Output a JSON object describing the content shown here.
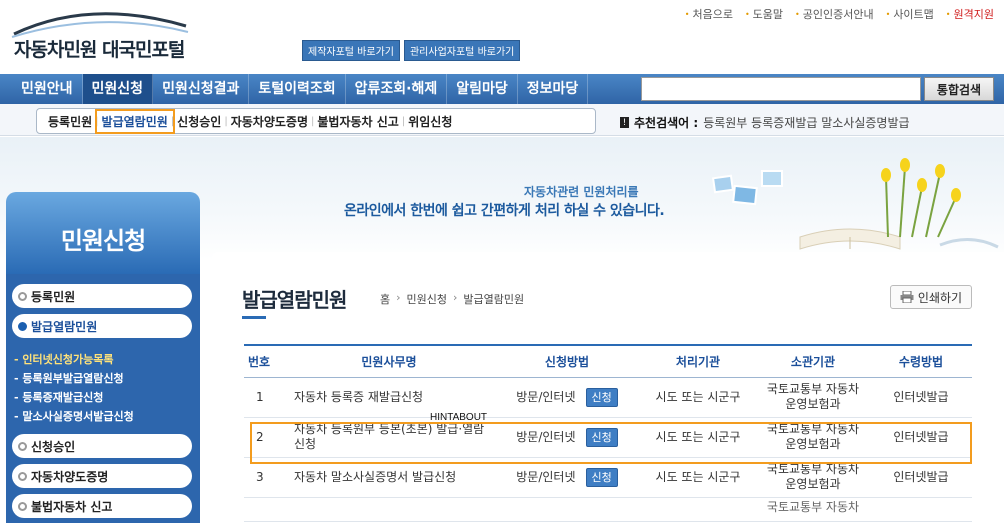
{
  "util_links": [
    {
      "label": "처음으로",
      "red": false
    },
    {
      "label": "도움말",
      "red": false
    },
    {
      "label": "공인인증서안내",
      "red": false
    },
    {
      "label": "사이트맵",
      "red": false
    },
    {
      "label": "원격지원",
      "red": true
    }
  ],
  "logo": {
    "text": "자동차민원 대국민포털"
  },
  "shortcuts": [
    "제작자포털 바로가기",
    "관리사업자포털 바로가기"
  ],
  "nav": {
    "items": [
      "민원안내",
      "민원신청",
      "민원신청결과",
      "토털이력조회",
      "압류조회·해제",
      "알림마당",
      "정보마당"
    ],
    "active_index": 1,
    "search_value": "",
    "search_button": "통합검색"
  },
  "subnav": {
    "items": [
      "등록민원",
      "발급열람민원",
      "신청승인",
      "자동차양도증명",
      "불법자동차 신고",
      "위임신청"
    ],
    "highlight_index": 1,
    "rec_label": "추천검색어 :",
    "rec_terms": "등록원부  등록증재발급  말소사실증명발급"
  },
  "banner": {
    "line1": "자동차관련 민원처리를",
    "line2": "온라인에서 한번에 쉽고 간편하게 처리 하실 수 있습니다."
  },
  "sidebar": {
    "title": "민원신청",
    "items": [
      "등록민원",
      "발급열람민원"
    ],
    "active_index": 1,
    "subitems": [
      "- 인터넷신청가능목록",
      "- 등록원부발급열람신청",
      "- 등록증재발급신청",
      "- 말소사실증명서발급신청"
    ],
    "items_after": [
      "신청승인",
      "자동차양도증명",
      "불법자동차 신고"
    ]
  },
  "page": {
    "title": "발급열람민원",
    "breadcrumb": [
      "홈",
      "민원신청",
      "발급열람민원"
    ],
    "print_label": "인쇄하기"
  },
  "table": {
    "headers": [
      "번호",
      "민원사무명",
      "신청방법",
      "처리기관",
      "소관기관",
      "수령방법"
    ],
    "apply_label": "신청",
    "rows": [
      {
        "no": "1",
        "name": "자동차 등록증 재발급신청",
        "method": "방문/인터넷",
        "proc": "시도 또는 시군구",
        "owner": "국토교통부 자동차\n운영보험과",
        "recv": "인터넷발급"
      },
      {
        "no": "2",
        "name": "자동차 등록원부 등본(초본) 발급·열람\n신청",
        "method": "방문/인터넷",
        "proc": "시도 또는 시군구",
        "owner": "국토교통부 자동차\n운영보험과",
        "recv": "인터넷발급"
      },
      {
        "no": "3",
        "name": "자동차 말소사실증명서 발급신청",
        "method": "방문/인터넷",
        "proc": "시도 또는 시군구",
        "owner": "국토교통부 자동차\n운영보험과",
        "recv": "인터넷발급"
      }
    ],
    "clipped_owner": "국토교통부 자동차"
  },
  "hint": "HINTABOUT",
  "colors": {
    "nav_blue": "#2f64a6",
    "highlight_orange": "#f39c1e",
    "remote_red": "#d01c1c"
  }
}
